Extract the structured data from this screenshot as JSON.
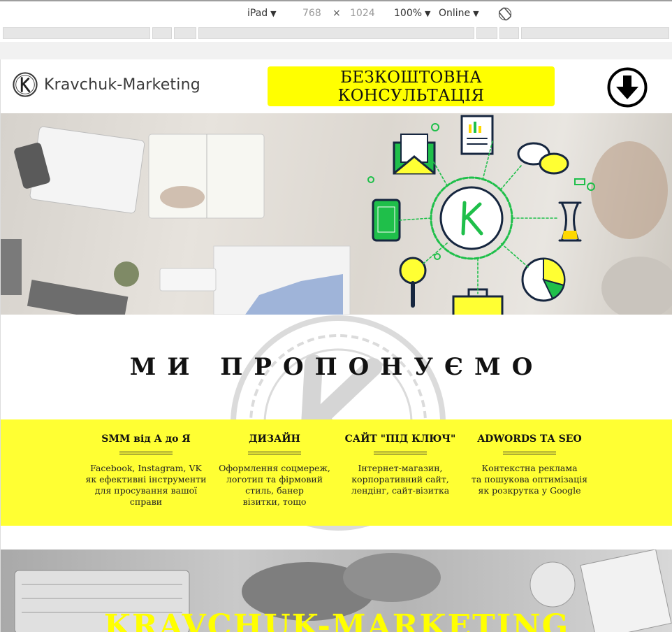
{
  "devtools": {
    "device": "iPad",
    "width": "768",
    "times": "×",
    "height": "1024",
    "zoom": "100%",
    "network": "Online",
    "caret": "▼"
  },
  "header": {
    "logo_text": "Kravchuk-Marketing",
    "cta_label": "БЕЗКОШТОВНА КОНСУЛЬТАЦІЯ"
  },
  "offers": {
    "title": "МИ ПРОПОНУЄМО",
    "items": [
      {
        "title": "SMM від А до Я",
        "lines": [
          "Facebook, Instagram, VK",
          "як ефективні інструменти",
          "для просування вашої",
          "справи"
        ]
      },
      {
        "title": "ДИЗАЙН",
        "lines": [
          "Оформлення соцмереж,",
          "логотип та фірмовий",
          "стиль, банер",
          "візитки, тощо"
        ]
      },
      {
        "title": "САЙТ \"ПІД КЛЮЧ\"",
        "lines": [
          "Інтернет-магазин,",
          "корпоративний сайт,",
          "лендінг, сайт-візитка"
        ]
      },
      {
        "title": "ADWORDS ТА SEO",
        "lines": [
          "Контекстна реклама",
          "та пошукова оптимізація",
          "як розкрутка у Google"
        ]
      }
    ]
  },
  "brand": {
    "title": "KRAVCHUK-MARKETING"
  },
  "colors": {
    "accent_yellow": "#ffff00",
    "band_yellow": "#ffff33",
    "icon_green": "#1fbf4a",
    "icon_navy": "#16263f"
  }
}
